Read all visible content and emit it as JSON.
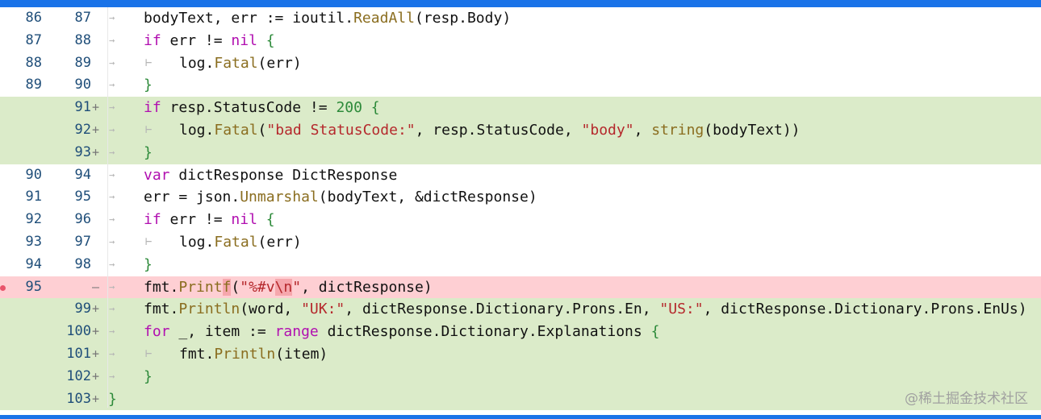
{
  "watermark": "@稀土掘金技术社区",
  "lines": [
    {
      "old": "86",
      "new": "87",
      "marker": "",
      "arrow": "→",
      "type": "context",
      "indent": 0,
      "code": "bodyText, err := ioutil.ReadAll(resp.Body)"
    },
    {
      "old": "87",
      "new": "88",
      "marker": "",
      "arrow": "→",
      "type": "context",
      "indent": 0,
      "code": "if err != nil {"
    },
    {
      "old": "88",
      "new": "89",
      "marker": "",
      "arrow": "→",
      "tab": "⊢",
      "type": "context",
      "indent": 1,
      "code": "log.Fatal(err)"
    },
    {
      "old": "89",
      "new": "90",
      "marker": "",
      "arrow": "→",
      "type": "context",
      "indent": 0,
      "code": "}"
    },
    {
      "old": "",
      "new": "91",
      "marker": "+",
      "arrow": "→",
      "type": "added",
      "indent": 0,
      "code": "if resp.StatusCode != 200 {"
    },
    {
      "old": "",
      "new": "92",
      "marker": "+",
      "arrow": "→",
      "tab": "⊢",
      "type": "added",
      "indent": 1,
      "code": "log.Fatal(\"bad StatusCode:\", resp.StatusCode, \"body\", string(bodyText))"
    },
    {
      "old": "",
      "new": "93",
      "marker": "+",
      "arrow": "→",
      "type": "added",
      "indent": 0,
      "code": "}"
    },
    {
      "old": "90",
      "new": "94",
      "marker": "",
      "arrow": "→",
      "type": "context",
      "indent": 0,
      "code": "var dictResponse DictResponse"
    },
    {
      "old": "91",
      "new": "95",
      "marker": "",
      "arrow": "→",
      "type": "context",
      "indent": 0,
      "code": "err = json.Unmarshal(bodyText, &dictResponse)"
    },
    {
      "old": "92",
      "new": "96",
      "marker": "",
      "arrow": "→",
      "type": "context",
      "indent": 0,
      "code": "if err != nil {"
    },
    {
      "old": "93",
      "new": "97",
      "marker": "",
      "arrow": "→",
      "tab": "⊢",
      "type": "context",
      "indent": 1,
      "code": "log.Fatal(err)"
    },
    {
      "old": "94",
      "new": "98",
      "marker": "",
      "arrow": "→",
      "type": "context",
      "indent": 0,
      "code": "}"
    },
    {
      "old": "95",
      "new": "",
      "marker": "—",
      "arrow": "→",
      "type": "removed",
      "indent": 0,
      "code": "fmt.Printf(\"%#v\\n\", dictResponse)"
    },
    {
      "old": "",
      "new": "99",
      "marker": "+",
      "arrow": "→",
      "type": "added",
      "indent": 0,
      "code": "fmt.Println(word, \"UK:\", dictResponse.Dictionary.Prons.En, \"US:\", dictResponse.Dictionary.Prons.EnUs)"
    },
    {
      "old": "",
      "new": "100",
      "marker": "+",
      "arrow": "→",
      "type": "added",
      "indent": 0,
      "code": "for _, item := range dictResponse.Dictionary.Explanations {"
    },
    {
      "old": "",
      "new": "101",
      "marker": "+",
      "arrow": "→",
      "tab": "⊢",
      "type": "added",
      "indent": 1,
      "code": "fmt.Println(item)"
    },
    {
      "old": "",
      "new": "102",
      "marker": "+",
      "arrow": "→",
      "type": "added",
      "indent": 0,
      "code": "}"
    },
    {
      "old": "",
      "new": "103",
      "marker": "+",
      "arrow": "",
      "type": "added",
      "indent": -1,
      "code": "}"
    }
  ]
}
